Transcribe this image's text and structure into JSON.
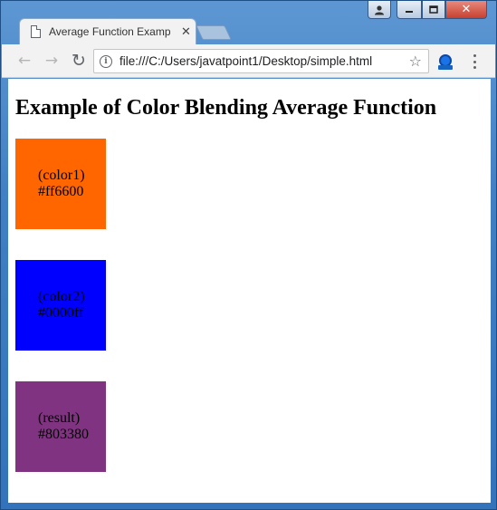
{
  "tab": {
    "title": "Average Function Examp",
    "close": "✕"
  },
  "toolbar": {
    "back": "←",
    "forward": "→",
    "reload": "↻",
    "info": "i",
    "url": "file:///C:/Users/javatpoint1/Desktop/simple.html",
    "star": "☆"
  },
  "window_controls": {
    "user": "👤",
    "minimize": "—",
    "maximize": "☐",
    "close": "✕"
  },
  "page": {
    "heading": "Example of Color Blending Average Function",
    "swatches": [
      {
        "label": "(color1)",
        "value": "#ff6600",
        "color": "#ff6600"
      },
      {
        "label": "(color2)",
        "value": "#0000ff",
        "color": "#0000ff"
      },
      {
        "label": "(result)",
        "value": "#803380",
        "color": "#803380"
      }
    ]
  }
}
